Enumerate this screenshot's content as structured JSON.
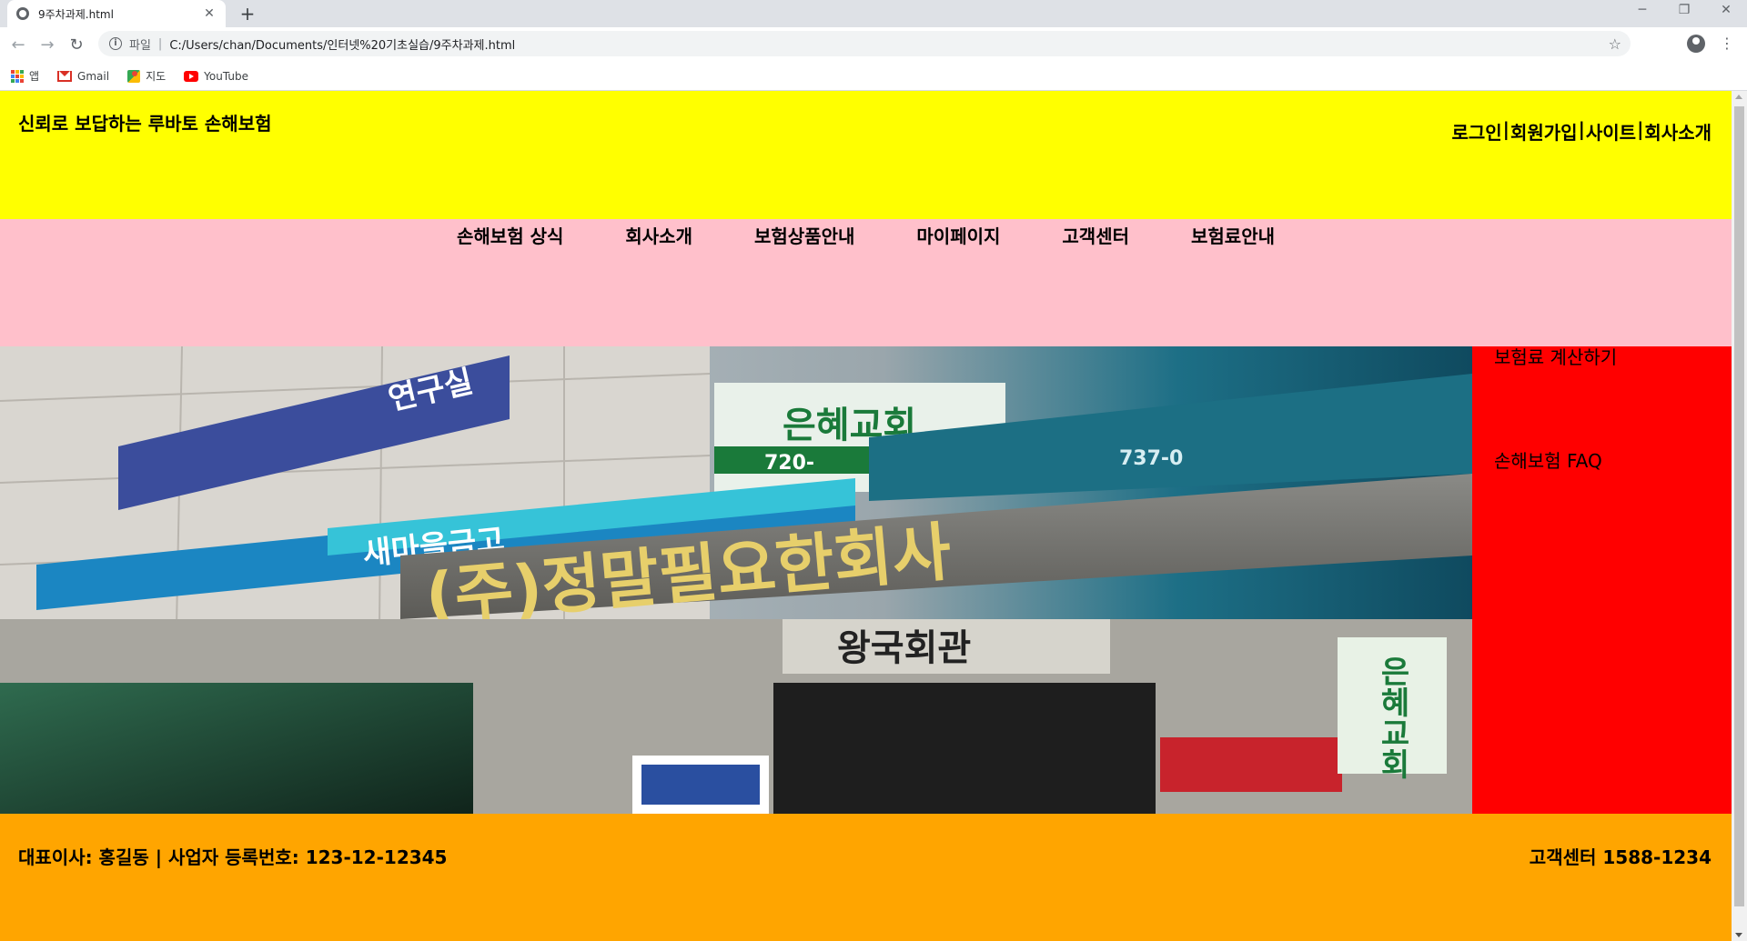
{
  "browser": {
    "tab_title": "9주차과제.html",
    "tab_close": "✕",
    "new_tab": "+",
    "window_min": "─",
    "window_max": "❐",
    "window_close": "✕",
    "nav_back": "←",
    "nav_forward": "→",
    "nav_reload": "↻",
    "address_scheme": "파일",
    "address_sep": "|",
    "address_url": "C:/Users/chan/Documents/인터넷%20기초실습/9주차과제.html",
    "star": "☆",
    "menu": "⋮",
    "bookmarks": [
      {
        "label": "앱",
        "icon": "apps-icon"
      },
      {
        "label": "Gmail",
        "icon": "gmail-icon"
      },
      {
        "label": "지도",
        "icon": "maps-icon"
      },
      {
        "label": "YouTube",
        "icon": "youtube-icon"
      }
    ]
  },
  "colors": {
    "header_bg": "#ffff00",
    "nav_bg": "#ffc0cb",
    "aside_bg": "#ff0000",
    "footer_bg": "#ffa500"
  },
  "header": {
    "title": "신뢰로 보답하는 루바토 손해보험",
    "links": [
      "로그인",
      "회원가입",
      "사이트",
      "회사소개"
    ],
    "link_separator": "|"
  },
  "nav": {
    "items": [
      "손해보험 상식",
      "회사소개",
      "보험상품안내",
      "마이페이지",
      "고객센터",
      "보험료안내"
    ]
  },
  "aside": {
    "links": [
      "보험료 계산하기",
      "손해보험 FAQ"
    ]
  },
  "hero": {
    "image": "building-storefront-photo",
    "signs": {
      "main_sign": "(주)정말필요한회사",
      "bank_sign": "새마을금고",
      "lower_sign": "왕국회관",
      "church_sign": "은혜교회",
      "vertical_sign": "은혜교회",
      "green_sign": "은혜교회",
      "top_sign": "연구실",
      "phone_partial": "720-",
      "phone_partial_2": "737-0"
    }
  },
  "footer": {
    "ceo_info": "대표이사: 홍길동 | 사업자 등록번호: 123-12-12345",
    "customer_center": "고객센터 1588-1234"
  }
}
